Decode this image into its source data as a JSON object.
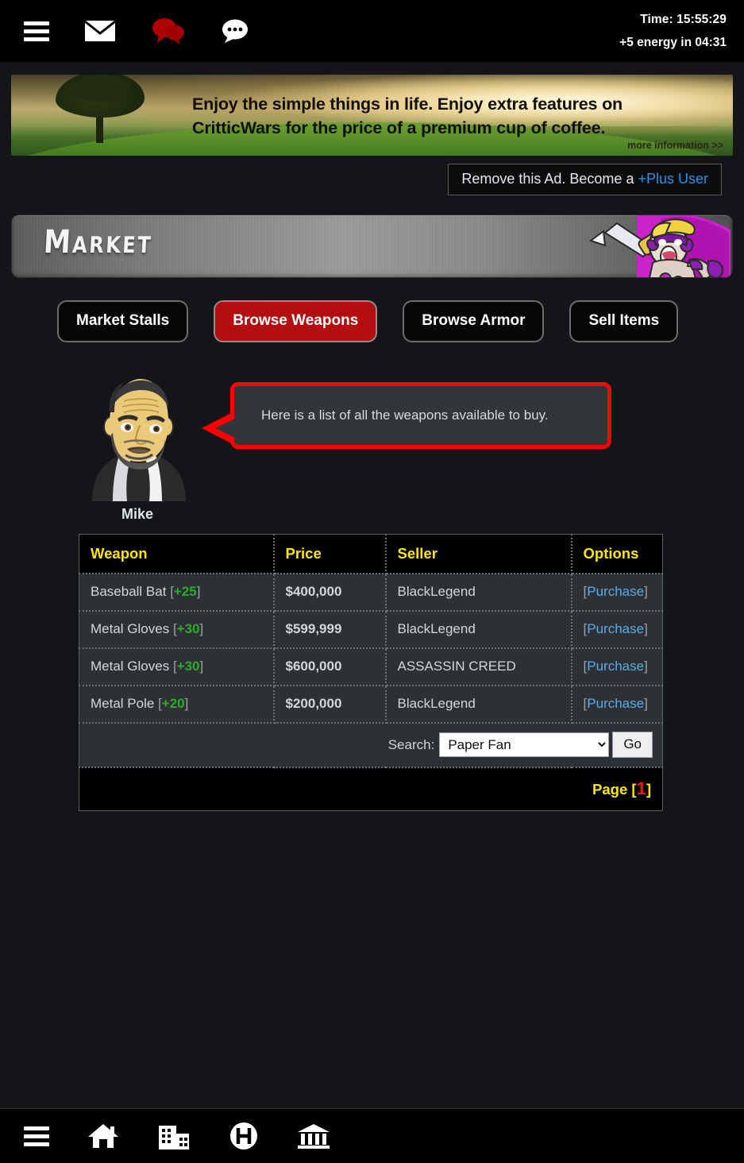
{
  "topbar": {
    "icons": [
      {
        "name": "hamburger-menu-icon",
        "label": "Menu"
      },
      {
        "name": "mail-icon",
        "label": "Mail"
      },
      {
        "name": "comments-icon",
        "label": "Comments"
      },
      {
        "name": "chat-icon",
        "label": "Chat"
      }
    ],
    "time": "Time: 15:55:29",
    "energy": "+5 energy in 04:31"
  },
  "ad": {
    "line1": "Enjoy the simple things in life. Enjoy extra features on",
    "line2": "CritticWars for the price of a premium cup of coffee.",
    "more_info": "more information >>",
    "remove_prefix": "Remove this Ad. Become a ",
    "remove_link": "+Plus User"
  },
  "page": {
    "title": "Market"
  },
  "tabs": [
    {
      "label": "Market Stalls",
      "active": false
    },
    {
      "label": "Browse Weapons",
      "active": true
    },
    {
      "label": "Browse Armor",
      "active": false
    },
    {
      "label": "Sell Items",
      "active": false
    }
  ],
  "npc": {
    "name": "Mike",
    "speech": "Here is a list of all the weapons available to buy."
  },
  "table": {
    "headers": [
      "Weapon",
      "Price",
      "Seller",
      "Options"
    ],
    "rows": [
      {
        "weapon": "Baseball Bat",
        "bonus": "+25",
        "price": "$400,000",
        "seller": "BlackLegend",
        "option": "Purchase"
      },
      {
        "weapon": "Metal Gloves",
        "bonus": "+30",
        "price": "$599,999",
        "seller": "BlackLegend",
        "option": "Purchase"
      },
      {
        "weapon": "Metal Gloves",
        "bonus": "+30",
        "price": "$600,000",
        "seller": "ASSASSIN CREED",
        "option": "Purchase"
      },
      {
        "weapon": "Metal Pole",
        "bonus": "+20",
        "price": "$200,000",
        "seller": "BlackLegend",
        "option": "Purchase"
      }
    ],
    "search_label": "Search:",
    "search_value": "Paper Fan",
    "search_options": [
      "Paper Fan"
    ],
    "go_label": "Go",
    "page_label": "Page",
    "page_number": "1"
  },
  "bottom_nav": [
    {
      "name": "hamburger-menu-icon",
      "label": "Menu"
    },
    {
      "name": "home-icon",
      "label": "Home"
    },
    {
      "name": "city-icon",
      "label": "City"
    },
    {
      "name": "hospital-icon",
      "label": "Hospital"
    },
    {
      "name": "bank-icon",
      "label": "Bank"
    }
  ],
  "colors": {
    "background": "#131518",
    "topbar": "#000000",
    "accent_red": "#b40e11",
    "header_yellow": "#ffe700",
    "link_blue": "#5aabe8",
    "bonus_green": "#2eaa2e",
    "row_bg": "#2d3136",
    "bubble_border": "#ff0000",
    "plus_user_blue": "#2f8fe0"
  }
}
